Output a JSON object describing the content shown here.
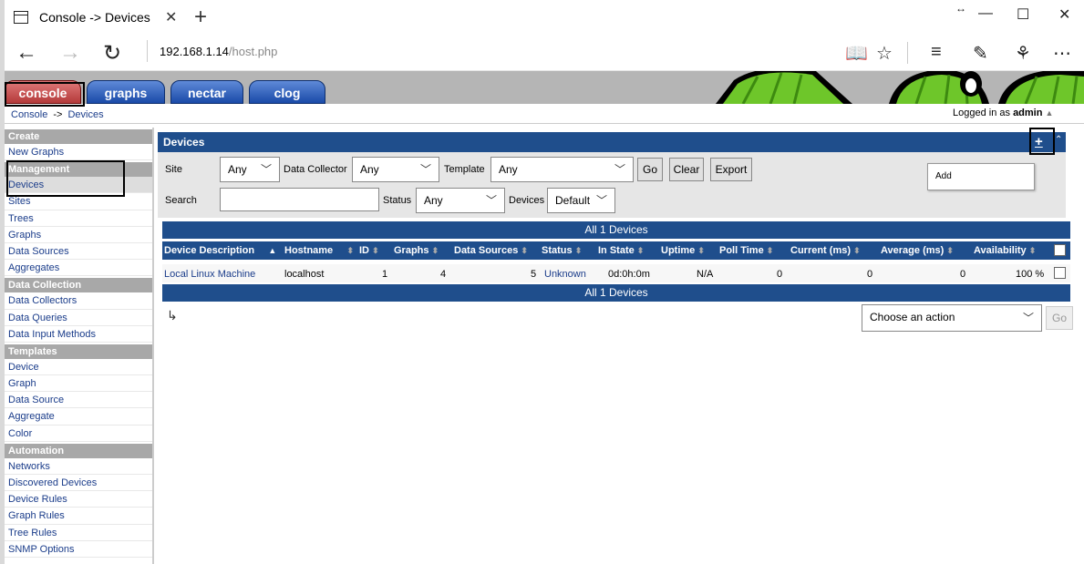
{
  "browser": {
    "tab_title": "Console -> Devices",
    "url_host": "192.168.1.14",
    "url_path": "/host.php"
  },
  "app": {
    "tabs": [
      "console",
      "graphs",
      "nectar",
      "clog"
    ],
    "breadcrumb": [
      "Console",
      "->",
      "Devices"
    ],
    "login_prefix": "Logged in as",
    "login_user": "admin"
  },
  "sidebar": {
    "groups": [
      {
        "title": "Create",
        "items": [
          "New Graphs"
        ]
      },
      {
        "title": "Management",
        "items": [
          "Devices",
          "Sites",
          "Trees",
          "Graphs",
          "Data Sources",
          "Aggregates"
        ]
      },
      {
        "title": "Data Collection",
        "items": [
          "Data Collectors",
          "Data Queries",
          "Data Input Methods"
        ]
      },
      {
        "title": "Templates",
        "items": [
          "Device",
          "Graph",
          "Data Source",
          "Aggregate",
          "Color"
        ]
      },
      {
        "title": "Automation",
        "items": [
          "Networks",
          "Discovered Devices",
          "Device Rules",
          "Graph Rules",
          "Tree Rules",
          "SNMP Options"
        ]
      }
    ],
    "active": "Devices"
  },
  "panel": {
    "title": "Devices",
    "plus": "+",
    "collapse": "⌃"
  },
  "filter": {
    "site_label": "Site",
    "site_value": "Any",
    "collector_label": "Data Collector",
    "collector_value": "Any",
    "template_label": "Template",
    "template_value": "Any",
    "go": "Go",
    "clear": "Clear",
    "export": "Export",
    "search_label": "Search",
    "search_value": "",
    "status_label": "Status",
    "status_value": "Any",
    "devices_label": "Devices",
    "devices_value": "Default"
  },
  "add_menu": {
    "item": "Add"
  },
  "table": {
    "summary": "All 1 Devices",
    "columns": [
      "Device Description",
      "Hostname",
      "ID",
      "Graphs",
      "Data Sources",
      "Status",
      "In State",
      "Uptime",
      "Poll Time",
      "Current (ms)",
      "Average (ms)",
      "Availability"
    ],
    "rows": [
      {
        "description": "Local Linux Machine",
        "hostname": "localhost",
        "id": "1",
        "graphs": "4",
        "data_sources": "5",
        "status": "Unknown",
        "in_state": "0d:0h:0m",
        "uptime": "N/A",
        "poll_time": "0",
        "current": "0",
        "average": "0",
        "availability": "100 %"
      }
    ]
  },
  "actions": {
    "placeholder": "Choose an action",
    "go": "Go"
  }
}
